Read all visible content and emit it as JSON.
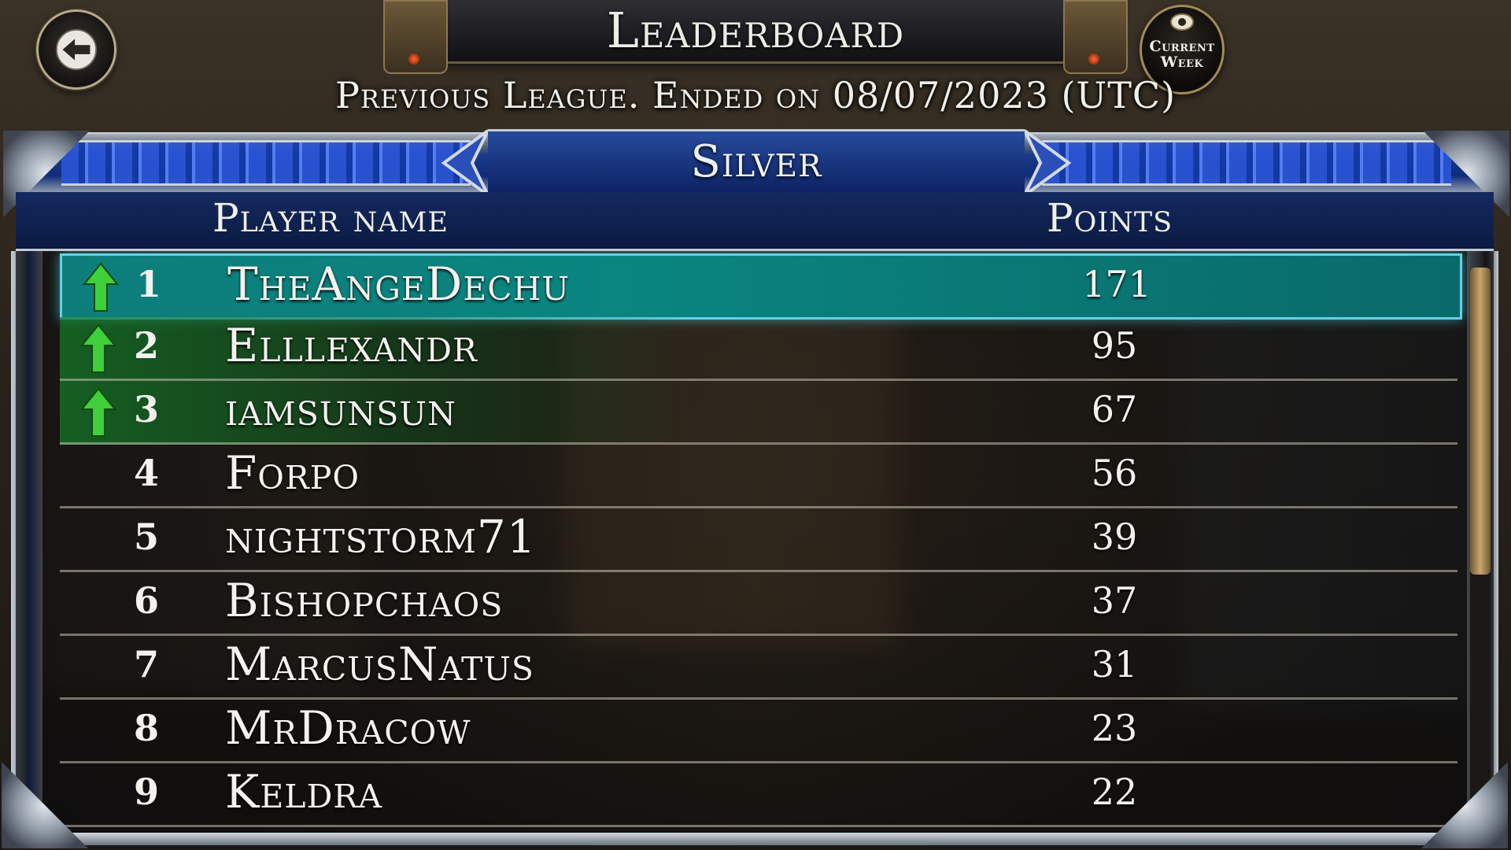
{
  "header": {
    "title": "Leaderboard",
    "back_icon": "back-arrow-icon",
    "current_week": [
      "Current",
      "Week"
    ],
    "current_week_icon": "eye-icon"
  },
  "subtitle": "Previous League. Ended on 08/07/2023 (UTC)",
  "tier": {
    "name": "Silver"
  },
  "columns": {
    "player": "Player name",
    "points": "Points"
  },
  "rows": [
    {
      "rank": "1",
      "name": "TheAngeDechu",
      "points": "171",
      "promoted": true
    },
    {
      "rank": "2",
      "name": "Elllexandr",
      "points": "95",
      "promoted": true
    },
    {
      "rank": "3",
      "name": "iamsunsun",
      "points": "67",
      "promoted": true
    },
    {
      "rank": "4",
      "name": "Forpo",
      "points": "56",
      "promoted": false
    },
    {
      "rank": "5",
      "name": "nightstorm71",
      "points": "39",
      "promoted": false
    },
    {
      "rank": "6",
      "name": "Bishopchaos",
      "points": "37",
      "promoted": false
    },
    {
      "rank": "7",
      "name": "MarcusNatus",
      "points": "31",
      "promoted": false
    },
    {
      "rank": "8",
      "name": "MrDracow",
      "points": "23",
      "promoted": false
    },
    {
      "rank": "9",
      "name": "Keldra",
      "points": "22",
      "promoted": false
    }
  ],
  "colors": {
    "highlight_row": "#0a8580",
    "promo_arrow": "#3fcf3a",
    "tier_blue": "#0e2c7a",
    "accent_gold": "#a48b58"
  }
}
